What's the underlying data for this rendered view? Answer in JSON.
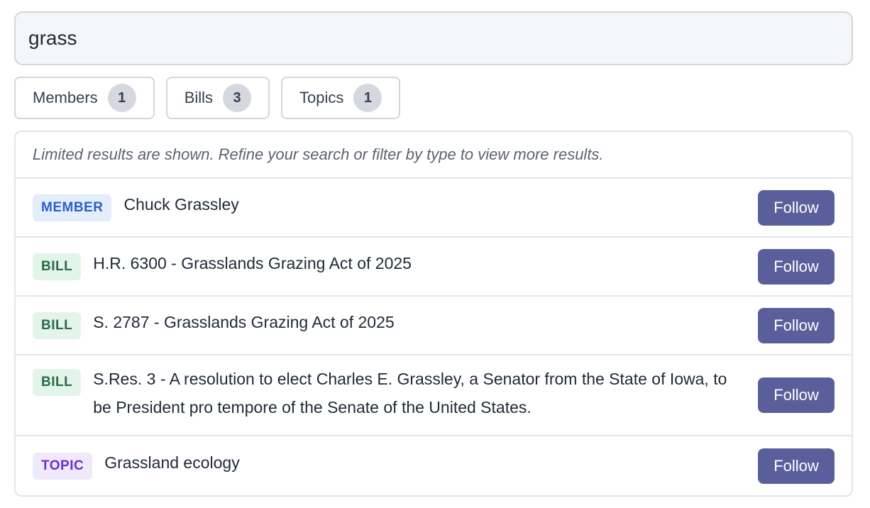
{
  "search": {
    "value": "grass"
  },
  "tabs": [
    {
      "label": "Members",
      "count": "1"
    },
    {
      "label": "Bills",
      "count": "3"
    },
    {
      "label": "Topics",
      "count": "1"
    }
  ],
  "notice": "Limited results are shown. Refine your search or filter by type to view more results.",
  "results": [
    {
      "type_label": "MEMBER",
      "title": "Chuck Grassley",
      "action": "Follow"
    },
    {
      "type_label": "BILL",
      "title": "H.R. 6300 - Grasslands Grazing Act of 2025",
      "action": "Follow"
    },
    {
      "type_label": "BILL",
      "title": "S. 2787 - Grasslands Grazing Act of 2025",
      "action": "Follow"
    },
    {
      "type_label": "BILL",
      "title": "S.Res. 3 - A resolution to elect Charles E. Grassley, a Senator from the State of Iowa, to be President pro tempore of the Senate of the United States.",
      "action": "Follow"
    },
    {
      "type_label": "TOPIC",
      "title": "Grassland ecology",
      "action": "Follow"
    }
  ],
  "colors": {
    "follow_button": "#5a5f9b",
    "member_badge_text": "#2c5fce",
    "bill_badge_text": "#2c6a45",
    "topic_badge_text": "#6a2fd0"
  }
}
